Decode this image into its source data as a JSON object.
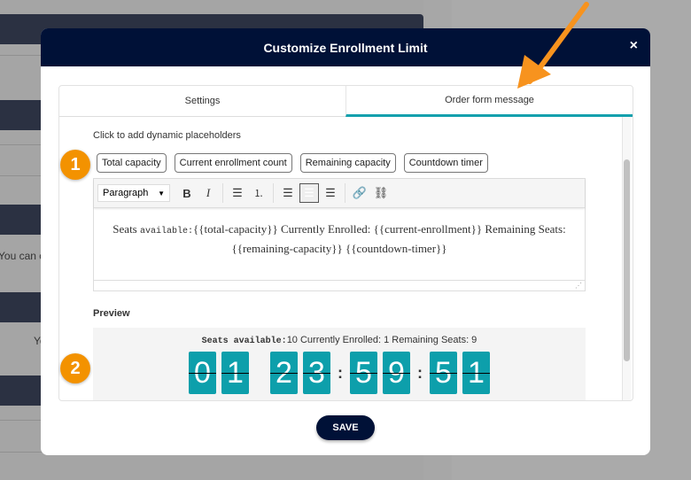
{
  "background": {
    "text1": "You can co",
    "text2": "Yo"
  },
  "modal": {
    "title": "Customize Enrollment Limit",
    "close_icon": "×",
    "tabs": [
      {
        "label": "Settings",
        "active": false
      },
      {
        "label": "Order form message",
        "active": true
      }
    ],
    "hint": "Click to add dynamic placeholders",
    "badges": [
      "1",
      "2"
    ],
    "placeholders": [
      "Total capacity",
      "Current enrollment count",
      "Remaining capacity",
      "Countdown timer"
    ],
    "toolbar": {
      "format": "Paragraph",
      "bold": "B",
      "italic": "I"
    },
    "editor": {
      "prefix": "Seats ",
      "mono": "available:",
      "rest": "{{total-capacity}} Currently Enrolled: {{current-enrollment}} Remaining Seats: {{remaining-capacity}} {{countdown-timer}}"
    },
    "preview": {
      "label": "Preview",
      "mono": "Seats available:",
      "rest": "10 Currently Enrolled: 1 Remaining Seats: 9",
      "digits": [
        "0",
        "1",
        "2",
        "3",
        "5",
        "9",
        "5",
        "1"
      ],
      "colon": ":"
    },
    "save_label": "SAVE"
  },
  "colors": {
    "header": "#001137",
    "accent": "#0d9fab",
    "badge": "#f39200",
    "arrow": "#f7931e"
  }
}
